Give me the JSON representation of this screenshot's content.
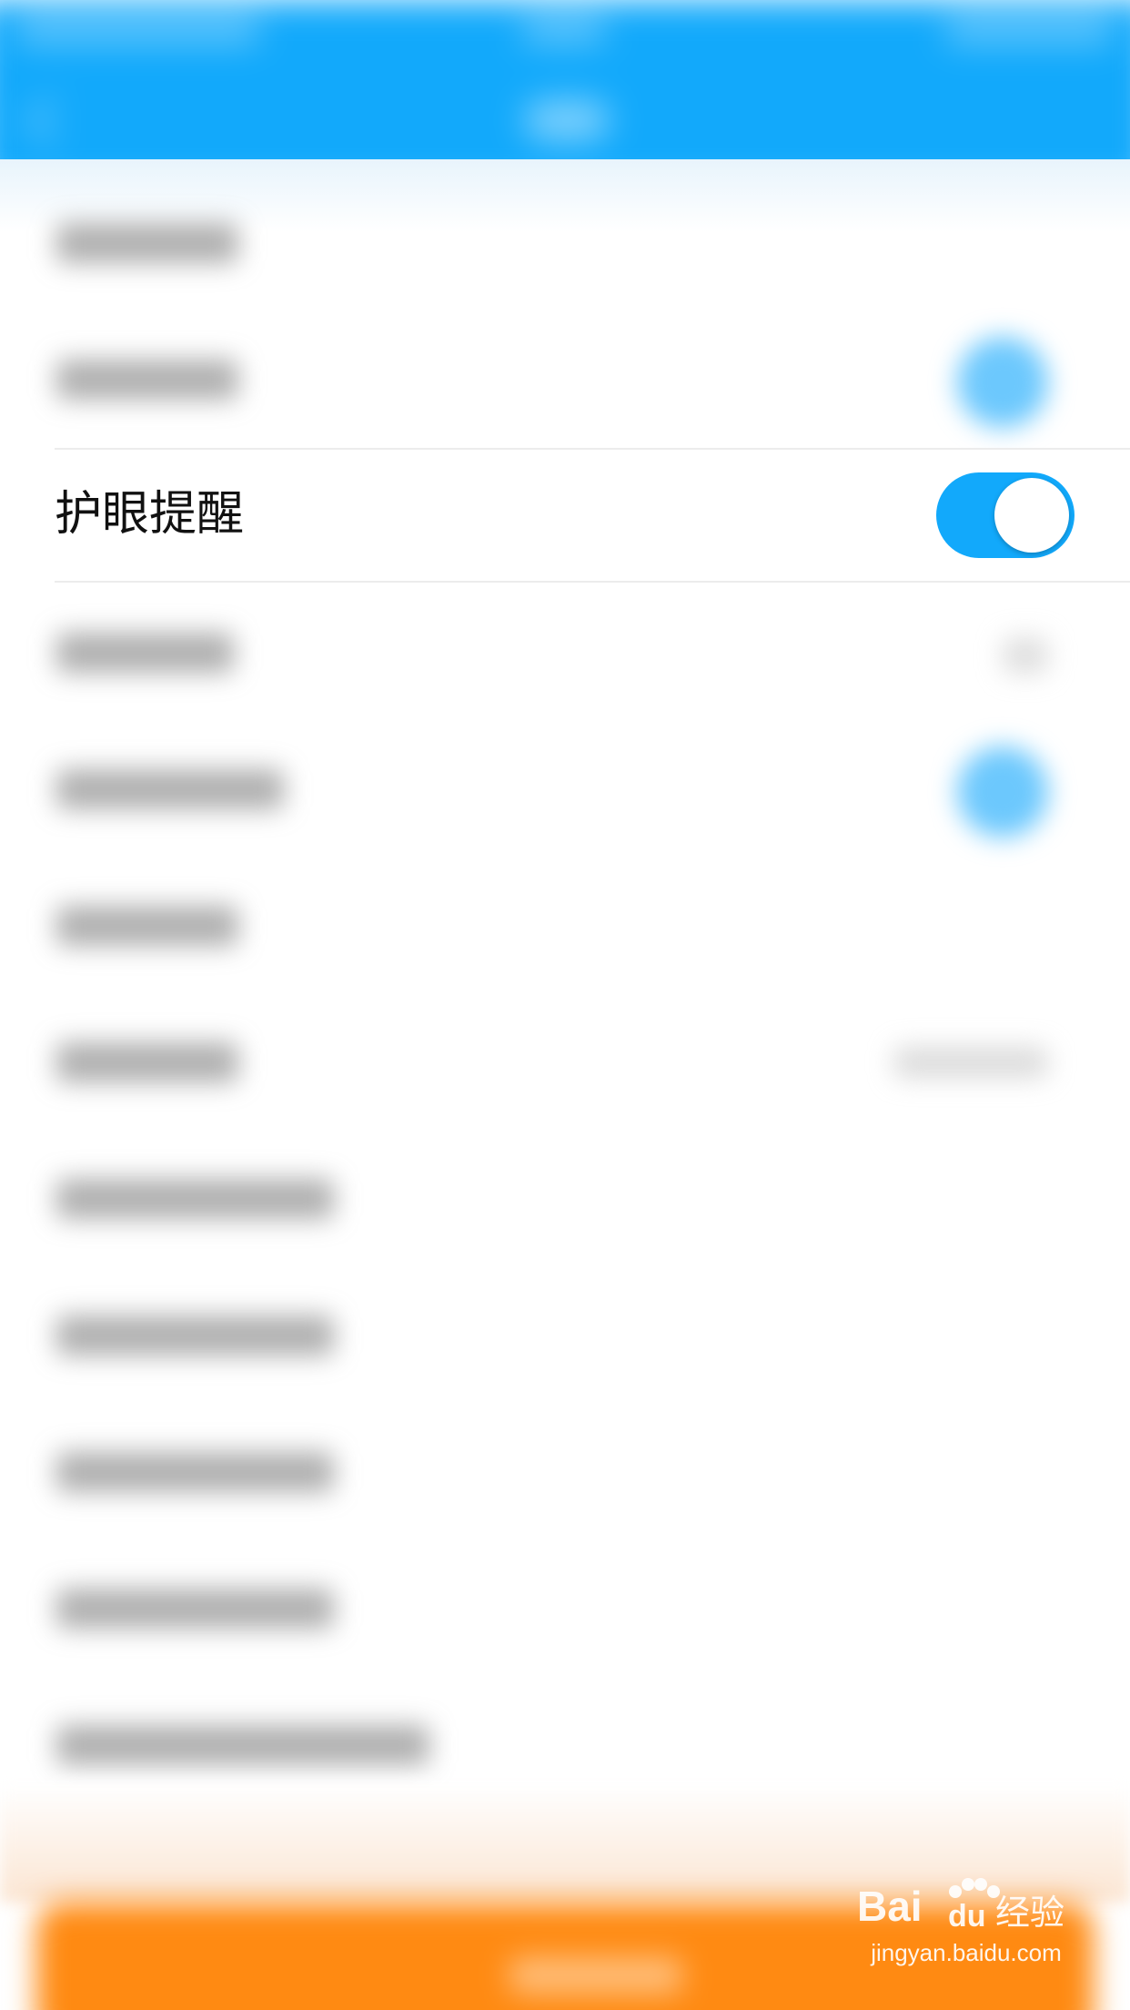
{
  "settings": {
    "eye_reminder": {
      "label": "护眼提醒",
      "enabled": true
    }
  },
  "colors": {
    "header": "#12a9fb",
    "toggle_on": "#12a9fb",
    "bottom_button": "#ff8a12",
    "label_text": "#111111"
  },
  "watermark": {
    "brand": "Baidu经验",
    "url": "jingyan.baidu.com"
  }
}
